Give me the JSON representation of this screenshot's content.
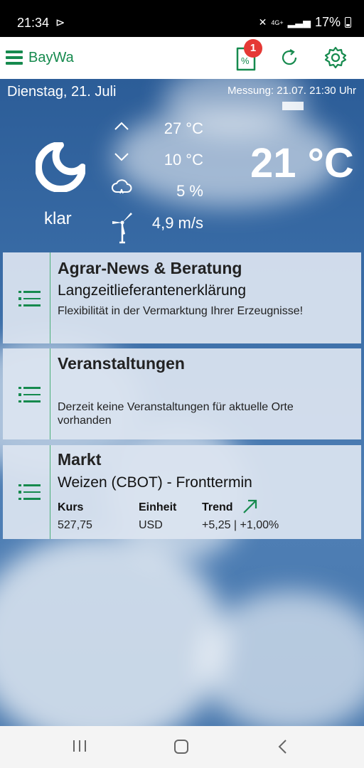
{
  "status": {
    "time": "21:34",
    "battery": "17%",
    "network": "4G+"
  },
  "app": {
    "brand": "BayWa",
    "badge_count": "1",
    "tag_text": "%"
  },
  "weather": {
    "date": "Dienstag, 21. Juli",
    "measurement": "Messung: 21.07. 21:30 Uhr",
    "condition": "klar",
    "temp_high": "27 °C",
    "temp_low": "10 °C",
    "precip": "5 %",
    "wind": "4,9 m/s",
    "current_temp": "21 °C"
  },
  "cards": {
    "news": {
      "title": "Agrar-News & Beratung",
      "subtitle": "Langzeitlieferantenerklärung",
      "description": "Flexibilität in der Vermarktung Ihrer Erzeugnisse!"
    },
    "events": {
      "title": "Veranstaltungen",
      "description": "Derzeit keine Veranstaltungen für aktuelle Orte vorhanden"
    },
    "market": {
      "title": "Markt",
      "subtitle": "Weizen (CBOT) - Fronttermin",
      "col_price": "Kurs",
      "col_unit": "Einheit",
      "col_trend": "Trend",
      "price": "527,75",
      "unit": "USD",
      "trend": "+5,25 | +1,00%"
    }
  },
  "colors": {
    "brand_green": "#168a4e",
    "badge_red": "#e53935"
  }
}
